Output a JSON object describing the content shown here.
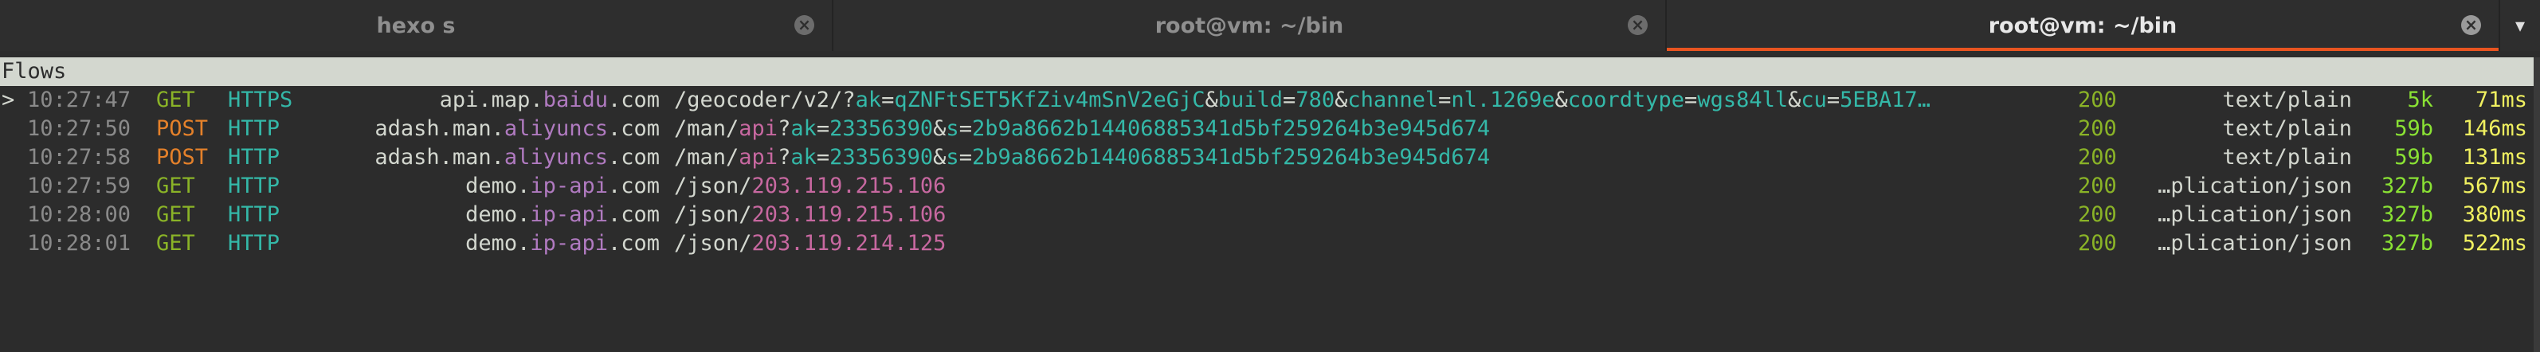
{
  "tabs": [
    {
      "title": "hexo s",
      "active": false
    },
    {
      "title": "root@vm: ~/bin",
      "active": false
    },
    {
      "title": "root@vm: ~/bin",
      "active": true
    }
  ],
  "tab_close_glyph": "×",
  "tab_menu_glyph": "▾",
  "flows_header": "Flows",
  "cursor_glyph": ">",
  "flows": [
    {
      "time": "10:27:47",
      "method": "GET",
      "scheme": "HTTPS",
      "host_prefix": "api.map.",
      "host_hl": "baidu",
      "host_suffix": ".com",
      "path_segments": [
        {
          "t": "/geocoder/v2/?",
          "c": "plain"
        },
        {
          "t": "ak",
          "c": "key"
        },
        {
          "t": "=",
          "c": "plain"
        },
        {
          "t": "qZNFtSET5KfZiv4mSnV2eGjC",
          "c": "val"
        },
        {
          "t": "&",
          "c": "plain"
        },
        {
          "t": "build",
          "c": "key"
        },
        {
          "t": "=",
          "c": "plain"
        },
        {
          "t": "780",
          "c": "val"
        },
        {
          "t": "&",
          "c": "plain"
        },
        {
          "t": "channel",
          "c": "key"
        },
        {
          "t": "=",
          "c": "plain"
        },
        {
          "t": "nl.1269e",
          "c": "val"
        },
        {
          "t": "&",
          "c": "plain"
        },
        {
          "t": "coordtype",
          "c": "key"
        },
        {
          "t": "=",
          "c": "plain"
        },
        {
          "t": "wgs84ll",
          "c": "val"
        },
        {
          "t": "&",
          "c": "plain"
        },
        {
          "t": "cu",
          "c": "key"
        },
        {
          "t": "=",
          "c": "plain"
        },
        {
          "t": "5EBA17…",
          "c": "val"
        }
      ],
      "code": "200",
      "content_type": "text/plain",
      "size": "5k",
      "duration": "71ms",
      "selected": true
    },
    {
      "time": "10:27:50",
      "method": "POST",
      "scheme": "HTTP",
      "host_prefix": "adash.man.",
      "host_hl": "aliyuncs",
      "host_suffix": ".com",
      "path_segments": [
        {
          "t": "/man/",
          "c": "plain"
        },
        {
          "t": "api",
          "c": "hl"
        },
        {
          "t": "?",
          "c": "plain"
        },
        {
          "t": "ak",
          "c": "key"
        },
        {
          "t": "=",
          "c": "plain"
        },
        {
          "t": "23356390",
          "c": "val"
        },
        {
          "t": "&",
          "c": "plain"
        },
        {
          "t": "s",
          "c": "key"
        },
        {
          "t": "=",
          "c": "plain"
        },
        {
          "t": "2b9a8662b14406885341d5bf259264b3e945d674",
          "c": "val"
        }
      ],
      "code": "200",
      "content_type": "text/plain",
      "size": "59b",
      "duration": "146ms",
      "selected": false
    },
    {
      "time": "10:27:58",
      "method": "POST",
      "scheme": "HTTP",
      "host_prefix": "adash.man.",
      "host_hl": "aliyuncs",
      "host_suffix": ".com",
      "path_segments": [
        {
          "t": "/man/",
          "c": "plain"
        },
        {
          "t": "api",
          "c": "hl"
        },
        {
          "t": "?",
          "c": "plain"
        },
        {
          "t": "ak",
          "c": "key"
        },
        {
          "t": "=",
          "c": "plain"
        },
        {
          "t": "23356390",
          "c": "val"
        },
        {
          "t": "&",
          "c": "plain"
        },
        {
          "t": "s",
          "c": "key"
        },
        {
          "t": "=",
          "c": "plain"
        },
        {
          "t": "2b9a8662b14406885341d5bf259264b3e945d674",
          "c": "val"
        }
      ],
      "code": "200",
      "content_type": "text/plain",
      "size": "59b",
      "duration": "131ms",
      "selected": false
    },
    {
      "time": "10:27:59",
      "method": "GET",
      "scheme": "HTTP",
      "host_prefix": "demo.",
      "host_hl": "ip-api",
      "host_suffix": ".com",
      "path_segments": [
        {
          "t": "/json/",
          "c": "plain"
        },
        {
          "t": "203.119.215.106",
          "c": "hl"
        }
      ],
      "code": "200",
      "content_type": "…plication/json",
      "size": "327b",
      "duration": "567ms",
      "selected": false
    },
    {
      "time": "10:28:00",
      "method": "GET",
      "scheme": "HTTP",
      "host_prefix": "demo.",
      "host_hl": "ip-api",
      "host_suffix": ".com",
      "path_segments": [
        {
          "t": "/json/",
          "c": "plain"
        },
        {
          "t": "203.119.215.106",
          "c": "hl"
        }
      ],
      "code": "200",
      "content_type": "…plication/json",
      "size": "327b",
      "duration": "380ms",
      "selected": false
    },
    {
      "time": "10:28:01",
      "method": "GET",
      "scheme": "HTTP",
      "host_prefix": "demo.",
      "host_hl": "ip-api",
      "host_suffix": ".com",
      "path_segments": [
        {
          "t": "/json/",
          "c": "plain"
        },
        {
          "t": "203.119.214.125",
          "c": "hl"
        }
      ],
      "code": "200",
      "content_type": "…plication/json",
      "size": "327b",
      "duration": "522ms",
      "selected": false
    }
  ],
  "colors": {
    "accent": "#e95420",
    "get": "#8ab327",
    "post": "#e5812a",
    "scheme": "#34b8a8",
    "host_highlight": "#b07ac0",
    "path_highlight": "#c768a0",
    "size": "#8ae234",
    "duration": "#f0f060"
  }
}
